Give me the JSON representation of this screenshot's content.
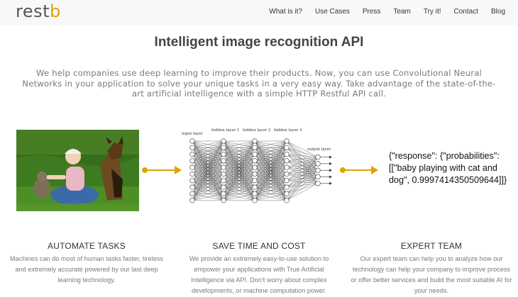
{
  "logo": {
    "text_main": "rest",
    "text_accent": "b"
  },
  "nav": {
    "items": [
      "What is it?",
      "Use Cases",
      "Press",
      "Team",
      "Try it!",
      "Contact",
      "Blog"
    ]
  },
  "hero": {
    "title": "Intelligent image recognition API",
    "intro": "We help companies use deep learning to improve their products. Now, you can use Convolutional Neural Networks in your application to solve your unique tasks in a very easy way. Take advantage of the state-of-the-art artificial intelligence with a simple HTTP Restful API call."
  },
  "diagram": {
    "layers": [
      "input layer",
      "hidden layer 1",
      "hidden layer 2",
      "hidden layer 3",
      "output layer"
    ],
    "response": "{\"response\": {\"probabilities\": [[\"baby playing with cat and dog\", 0.9997414350509644]]}"
  },
  "features": [
    {
      "title": "AUTOMATE TASKS",
      "text": "Machines can do most of human tasks faster, tireless and extremely accurate powered by our last deep learning technology."
    },
    {
      "title": "SAVE TIME AND COST",
      "text": "We provide an extremely easy-to-use solution to empower your applications with True Artificial Intelligence via API. Don't worry about complex developments, or machine computation power."
    },
    {
      "title": "EXPERT TEAM",
      "text": "Our expert team can help you to analyze how our technology can help your company to improve process or offer better services and build the most suitable AI for your needs."
    }
  ],
  "colors": {
    "accent": "#e0a300",
    "header_bg": "#f8f8f8"
  }
}
